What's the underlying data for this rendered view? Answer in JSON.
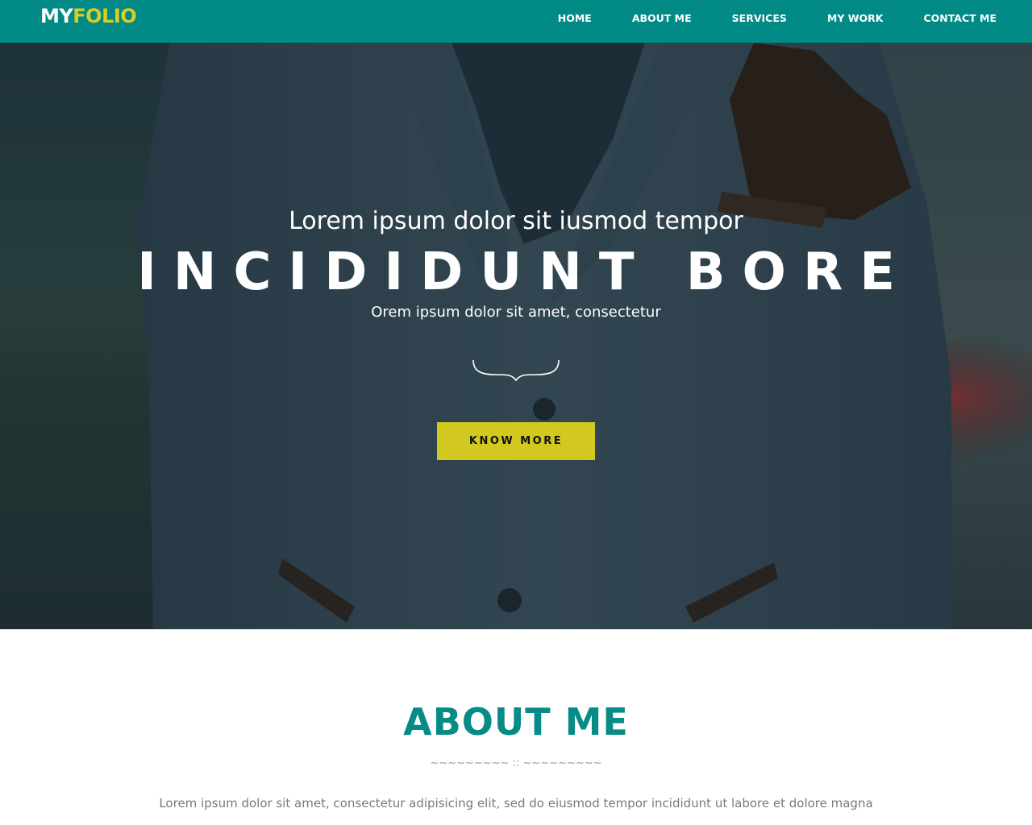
{
  "header": {
    "logo_prefix": "MY",
    "logo_suffix": "FOLIO",
    "nav": [
      "HOME",
      "ABOUT ME",
      "SERVICES",
      "MY WORK",
      "CONTACT ME"
    ]
  },
  "hero": {
    "kicker": "Lorem ipsum dolor sit iusmod tempor",
    "title": "INCIDIDUNT BORE",
    "subtitle": "Orem ipsum dolor sit amet, consectetur",
    "button_label": "KNOW MORE"
  },
  "about": {
    "title": "ABOUT ME",
    "divider": "~~~~~~~~~ :: ~~~~~~~~~",
    "text": "Lorem ipsum dolor sit amet, consectetur adipisicing elit, sed do eiusmod tempor incididunt ut labore et dolore magna"
  },
  "colors": {
    "header_bg": "#028a86",
    "accent_yellow": "#d1c920",
    "about_title": "#068b86"
  }
}
